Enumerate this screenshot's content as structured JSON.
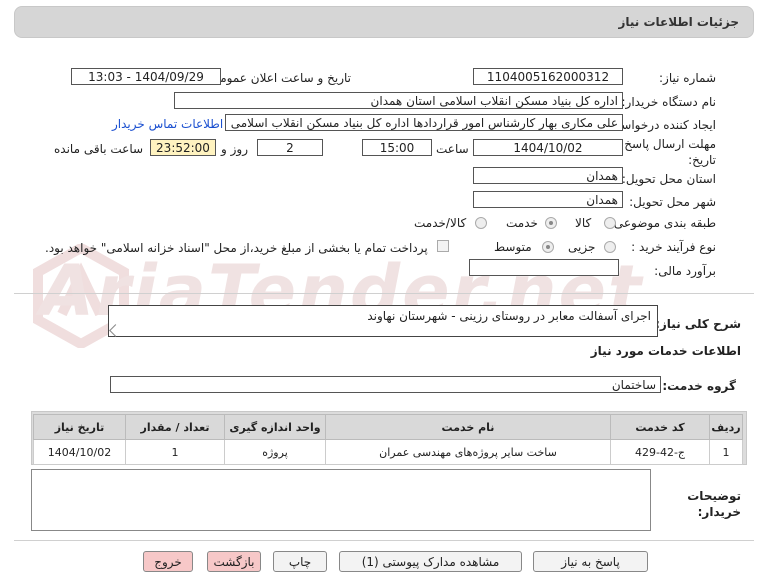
{
  "header": {
    "title": "جزئیات اطلاعات نیاز"
  },
  "watermark": {
    "text": "AriaTender.net"
  },
  "form": {
    "need_number_label": "شماره نیاز:",
    "need_number": "1104005162000312",
    "announce_label": "تاریخ و ساعت اعلان عمومی:",
    "announce_value": "1404/09/29 - 13:03",
    "buyer_org_label": "نام دستگاه خریدار:",
    "buyer_org": "اداره کل بنیاد مسکن انقلاب اسلامی استان همدان",
    "creator_label": "ایجاد کننده درخواست:",
    "creator": "علی مکاری بهار کارشناس امور قراردادها اداره کل بنیاد مسکن انقلاب اسلامی استان همدان",
    "contact_link": "اطلاعات تماس خریدار",
    "deadline_label": "مهلت ارسال پاسخ: تا تاریخ:",
    "deadline_date": "1404/10/02",
    "time_label": "ساعت",
    "deadline_time": "15:00",
    "days_value": "2",
    "days_label": "روز و",
    "remaining_time": "23:52:00",
    "remaining_label": "ساعت باقی مانده",
    "province_label": "استان محل تحویل:",
    "province": "همدان",
    "city_label": "شهر محل تحویل:",
    "city": "همدان",
    "category_label": "طبقه بندی موضوعی:",
    "category_options": [
      "کالا",
      "خدمت",
      "کالا/خدمت"
    ],
    "category_selected": "خدمت",
    "purchase_type_label": "نوع فرآیند خرید :",
    "purchase_options": [
      "جزیی",
      "متوسط"
    ],
    "purchase_selected": "متوسط",
    "payment_note": "پرداخت تمام یا بخشی از مبلغ خرید،از محل \"اسناد خزانه اسلامی\" خواهد بود.",
    "estimate_label": "برآورد مالی:",
    "estimate_value": ""
  },
  "description": {
    "label": "شرح کلی نیاز:",
    "text": "اجرای آسفالت معابر در روستای رزینی - شهرستان نهاوند"
  },
  "services": {
    "section_title": "اطلاعات خدمات مورد نیاز",
    "group_label": "گروه خدمت:",
    "group_value": "ساختمان",
    "columns": [
      "ردیف",
      "کد خدمت",
      "نام خدمت",
      "واحد اندازه گیری",
      "تعداد / مقدار",
      "تاریخ نیاز"
    ],
    "rows": [
      [
        "1",
        "ج-42-429",
        "ساخت سایر پروژه‌های مهندسی عمران",
        "پروژه",
        "1",
        "1404/10/02"
      ]
    ]
  },
  "buyer_notes": {
    "label_line1": "توضیحات",
    "label_line2": "خریدار:",
    "text": ""
  },
  "buttons": {
    "reply": "پاسخ به نیاز",
    "attachments": "مشاهده مدارک پیوستی (1)",
    "print": "چاپ",
    "back": "بازگشت",
    "exit": "خروج"
  }
}
